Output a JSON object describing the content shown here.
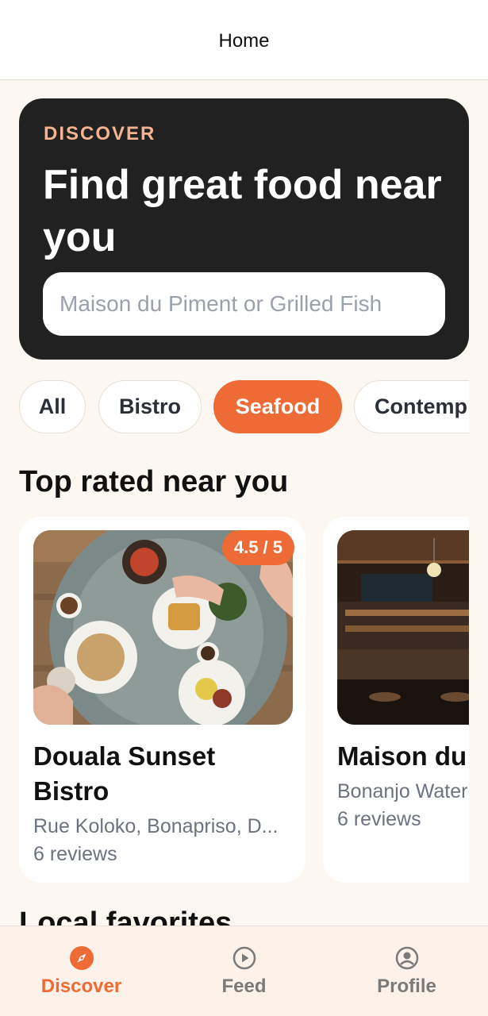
{
  "header": {
    "title": "Home"
  },
  "hero": {
    "eyebrow": "DISCOVER",
    "headline": "Find great food near you",
    "search_placeholder": "Maison du Piment or Grilled Fish"
  },
  "filters": {
    "chips": [
      "All",
      "Bistro",
      "Seafood",
      "Contemp"
    ],
    "selected": "Seafood"
  },
  "top_rated": {
    "title": "Top rated near you",
    "cards": [
      {
        "name": "Douala Sunset Bistro",
        "address": "Rue Koloko, Bonapriso, D...",
        "reviews": "6 reviews",
        "rating": "4.5 / 5"
      },
      {
        "name": "Maison du",
        "address": "Bonanjo Water",
        "reviews": "6 reviews"
      }
    ]
  },
  "local_favorites": {
    "title": "Local favorites"
  },
  "tabbar": {
    "tabs": [
      {
        "label": "Discover",
        "icon": "compass-icon",
        "active": true
      },
      {
        "label": "Feed",
        "icon": "play-circle-icon",
        "active": false
      },
      {
        "label": "Profile",
        "icon": "user-circle-icon",
        "active": false
      }
    ]
  },
  "colors": {
    "accent": "#ee6b36",
    "hero_bg": "#212121",
    "page_bg": "#fdf7f1",
    "eyebrow": "#f5b38f"
  }
}
